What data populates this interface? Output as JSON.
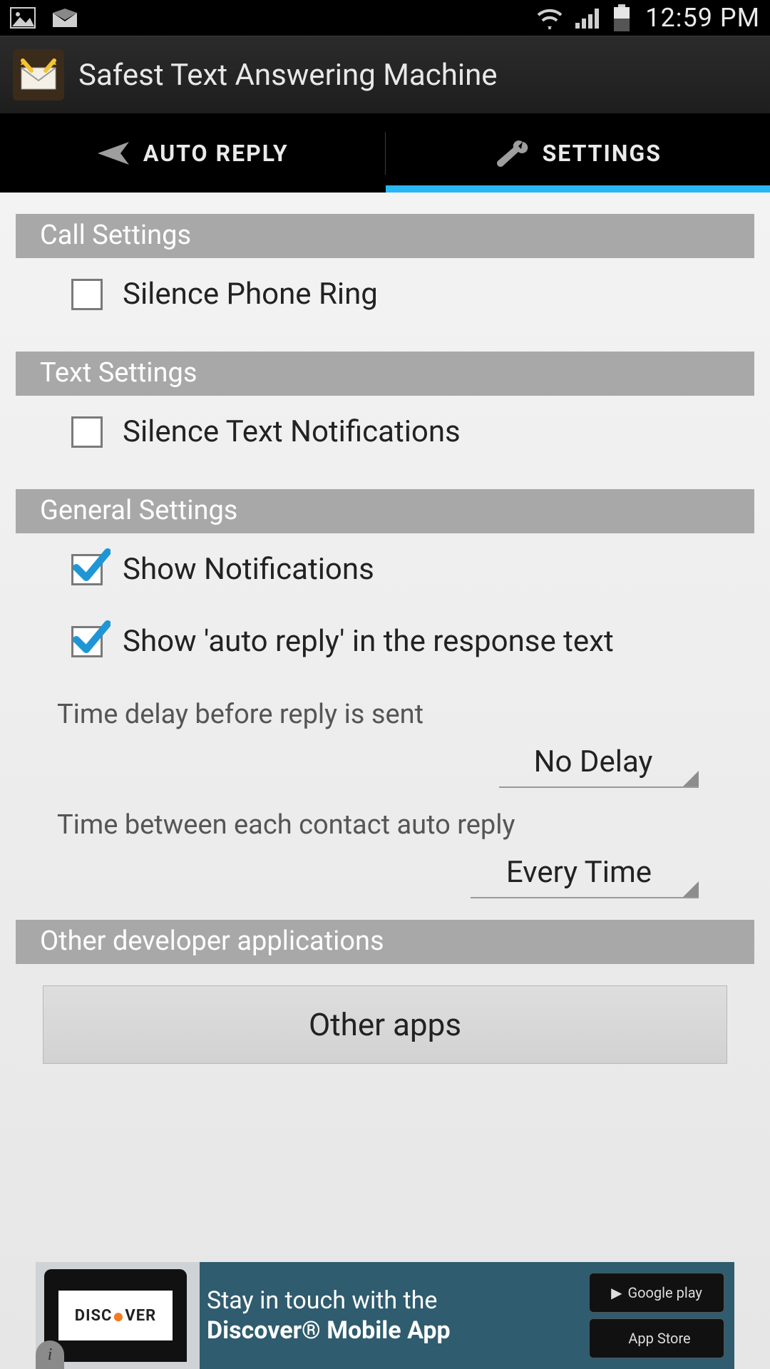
{
  "status": {
    "time": "12:59 PM"
  },
  "header": {
    "title": "Safest Text Answering Machine"
  },
  "tabs": {
    "auto_reply": "AUTO REPLY",
    "settings": "SETTINGS",
    "active": "settings"
  },
  "sections": {
    "call": {
      "title": "Call Settings",
      "items": [
        {
          "label": "Silence Phone Ring",
          "checked": false
        }
      ]
    },
    "text": {
      "title": "Text Settings",
      "items": [
        {
          "label": "Silence Text Notifications",
          "checked": false
        }
      ]
    },
    "general": {
      "title": "General Settings",
      "items": [
        {
          "label": "Show Notifications",
          "checked": true
        },
        {
          "label": "Show 'auto reply' in the response text",
          "checked": true
        }
      ],
      "delay_label": "Time delay before reply is sent",
      "delay_value": "No Delay",
      "interval_label": "Time between each contact auto reply",
      "interval_value": "Every Time"
    },
    "other": {
      "title": "Other developer applications",
      "button": "Other apps"
    }
  },
  "ad": {
    "brand": "DISCOVER",
    "line1": "Stay in touch with the",
    "line2": "Discover® Mobile App",
    "badge1": "Google play",
    "badge2": "App Store"
  }
}
